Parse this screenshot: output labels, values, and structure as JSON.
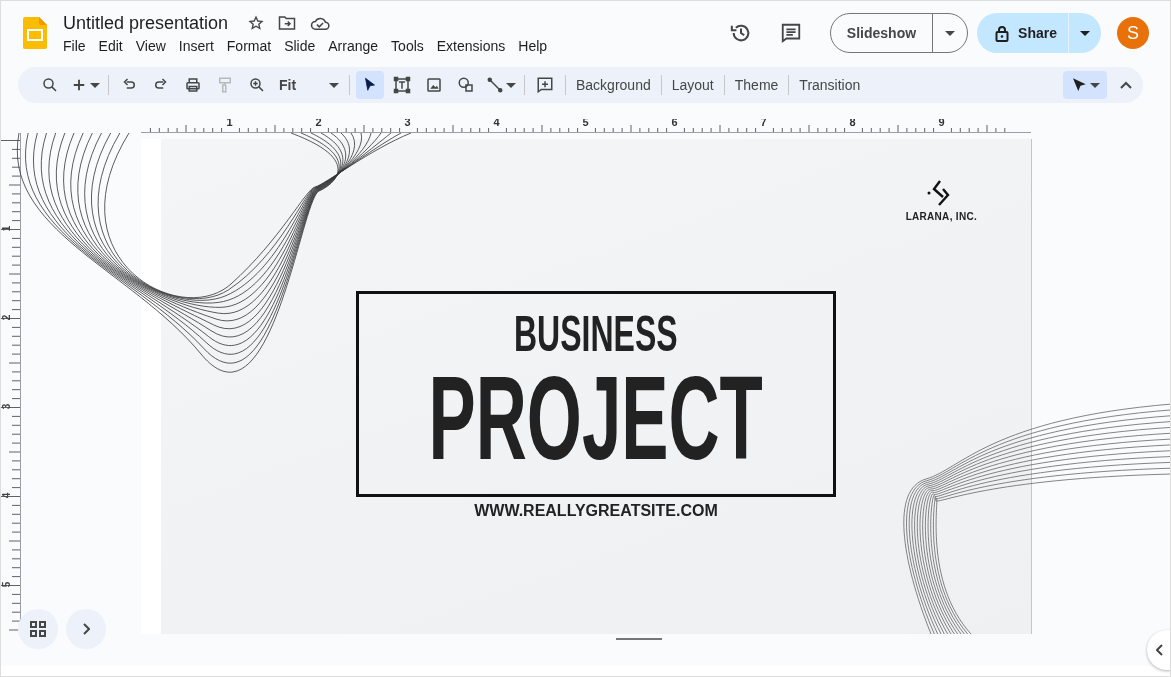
{
  "document": {
    "title": "Untitled presentation"
  },
  "menu": [
    "File",
    "Edit",
    "View",
    "Insert",
    "Format",
    "Slide",
    "Arrange",
    "Tools",
    "Extensions",
    "Help"
  ],
  "header": {
    "slideshow_button": "Slideshow",
    "share_button": "Share",
    "avatar": "S"
  },
  "toolbar": {
    "groups": [
      [
        {
          "kind": "search",
          "selected": false,
          "disabled": false,
          "dropdown": false
        },
        {
          "kind": "add",
          "selected": false,
          "disabled": false,
          "dropdown": true
        }
      ],
      [
        {
          "kind": "undo",
          "selected": false,
          "disabled": false,
          "dropdown": false
        },
        {
          "kind": "redo",
          "selected": false,
          "disabled": false,
          "dropdown": false
        },
        {
          "kind": "print",
          "selected": false,
          "disabled": false,
          "dropdown": false
        },
        {
          "kind": "paint",
          "selected": false,
          "disabled": true,
          "dropdown": false
        },
        {
          "kind": "zoom",
          "selected": false,
          "disabled": false,
          "dropdown": false
        },
        {
          "kind": "zoom-field",
          "value": "Fit",
          "selected": false,
          "disabled": false,
          "dropdown": true
        }
      ],
      [
        {
          "kind": "select",
          "selected": true,
          "disabled": false,
          "dropdown": false
        },
        {
          "kind": "textbox",
          "selected": false,
          "disabled": false,
          "dropdown": false
        },
        {
          "kind": "image",
          "selected": false,
          "disabled": false,
          "dropdown": false
        },
        {
          "kind": "shape",
          "selected": false,
          "disabled": false,
          "dropdown": false
        },
        {
          "kind": "line",
          "selected": false,
          "disabled": false,
          "dropdown": true
        }
      ],
      [
        {
          "kind": "comment",
          "selected": false,
          "disabled": false,
          "dropdown": false
        }
      ]
    ],
    "buttons": [
      "Background",
      "Layout",
      "Theme",
      "Transition"
    ],
    "mode_tool": {
      "selected": true
    }
  },
  "rulers": {
    "horizontal": [
      "1",
      "2",
      "3",
      "4",
      "5",
      "6",
      "7",
      "8",
      "9"
    ],
    "vertical": [
      "1",
      "2",
      "3",
      "4",
      "5"
    ]
  },
  "slide": {
    "logo_text": "LARANA, INC.",
    "title_top": "BUSINESS",
    "title_main": "PROJECT",
    "website": "WWW.REALLYGREATSITE.COM"
  }
}
